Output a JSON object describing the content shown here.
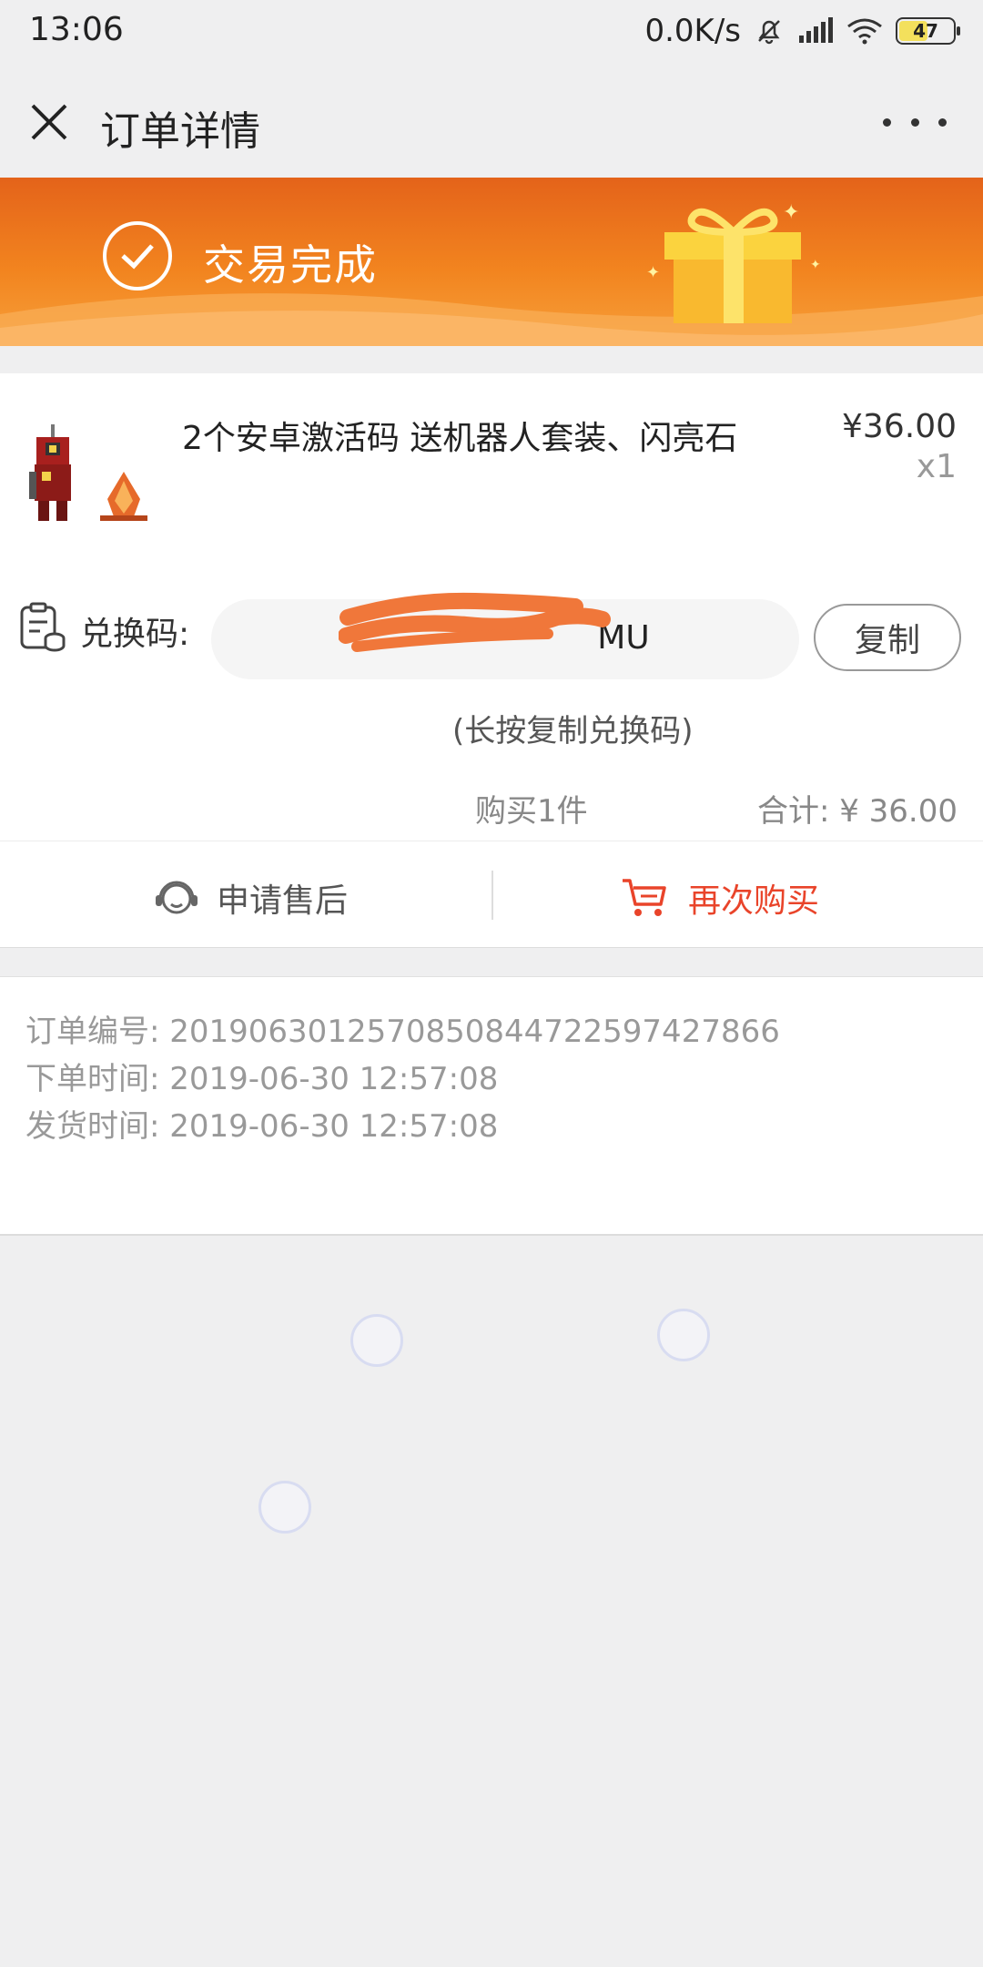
{
  "status_bar": {
    "time": "13:06",
    "net_speed": "0.0K/s",
    "battery": "47"
  },
  "nav": {
    "title": "订单详情"
  },
  "banner": {
    "status": "交易完成"
  },
  "product": {
    "title": "2个安卓激活码 送机器人套装、闪亮石",
    "price": "¥36.00",
    "quantity": "x1"
  },
  "redeem": {
    "label": "兑换码:",
    "code_visible": "MU",
    "copy_label": "复制",
    "hint": "(长按复制兑换码)"
  },
  "summary": {
    "count": "购买1件",
    "total": "合计: ¥ 36.00"
  },
  "actions": {
    "after_sale": "申请售后",
    "buy_again": "再次购买"
  },
  "order_info": {
    "order_no": "订单编号: 2019063012570850844722597427866",
    "order_time": "下单时间: 2019-06-30 12:57:08",
    "ship_time": "发货时间: 2019-06-30 12:57:08"
  },
  "colors": {
    "banner": "#f2841f",
    "accent_red": "#e9442a"
  }
}
